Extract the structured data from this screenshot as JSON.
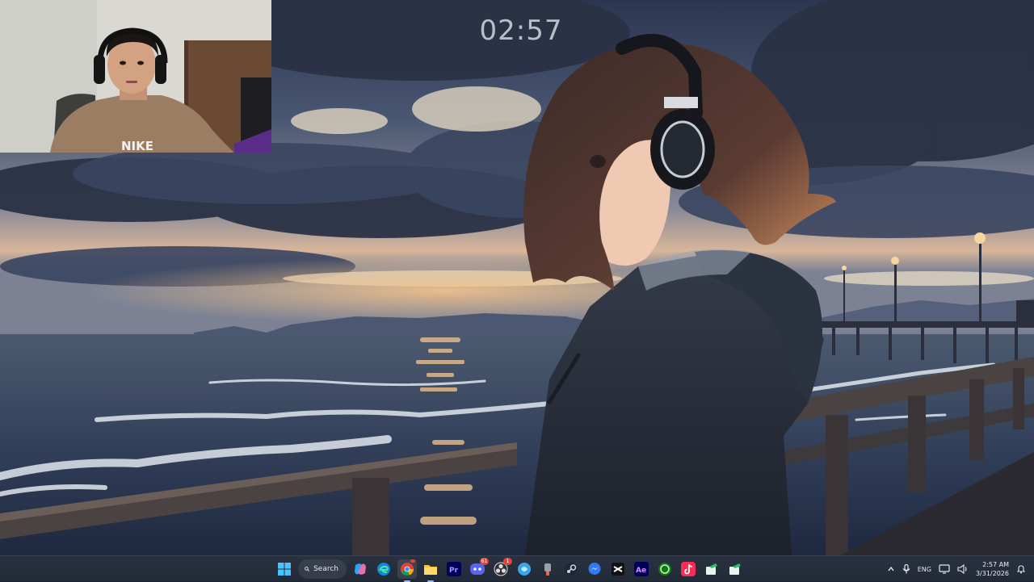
{
  "desktop": {
    "clock_widget": "02:57"
  },
  "webcam": {
    "shirt_text": "NIKE"
  },
  "taskbar": {
    "start_icon": "windows-start-icon",
    "search_label": "Search",
    "apps": [
      {
        "name": "copilot-icon"
      },
      {
        "name": "edge-icon"
      },
      {
        "name": "chrome-icon",
        "badge": "",
        "active": true
      },
      {
        "name": "file-explorer-icon",
        "active": true
      },
      {
        "name": "premiere-pro-icon",
        "label": "Pr"
      },
      {
        "name": "discord-icon",
        "badge": "61"
      },
      {
        "name": "obs-icon",
        "badge": "1"
      },
      {
        "name": "app-blue-icon"
      },
      {
        "name": "paint-icon"
      },
      {
        "name": "steam-icon"
      },
      {
        "name": "messenger-icon"
      },
      {
        "name": "capcut-icon"
      },
      {
        "name": "after-effects-icon",
        "label": "Ae"
      },
      {
        "name": "xbox-icon"
      },
      {
        "name": "tiktok-icon"
      },
      {
        "name": "app-green-1-icon"
      },
      {
        "name": "app-green-2-icon"
      }
    ],
    "tray": {
      "language": "ENG",
      "time": "2:57 AM",
      "date": "3/31/2026"
    }
  }
}
